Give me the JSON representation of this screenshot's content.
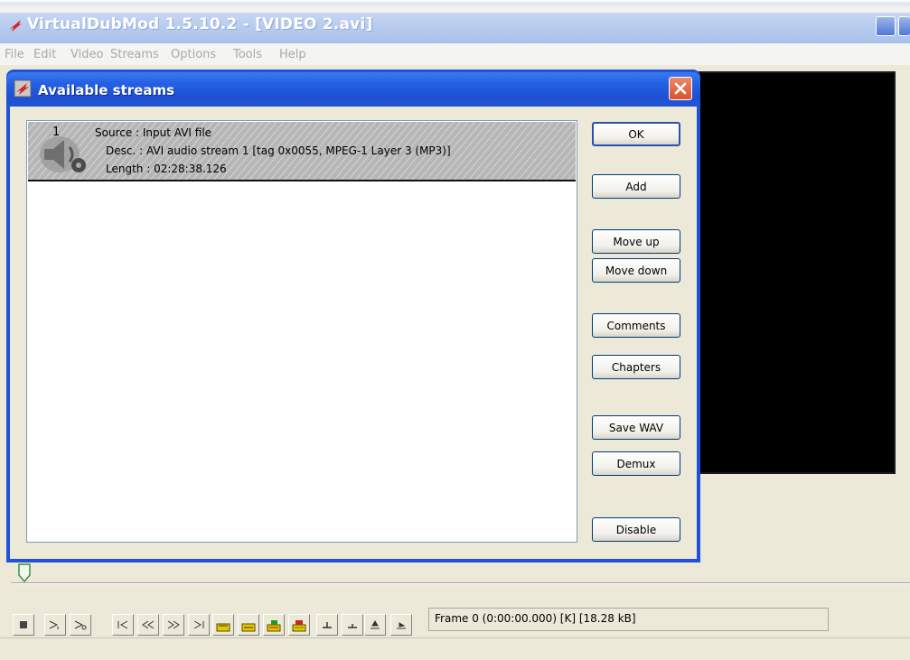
{
  "app": {
    "title": "VirtualDubMod 1.5.10.2 - [VIDEO 2.avi]",
    "menu": [
      "File",
      "Edit",
      "Video",
      "Streams",
      "Options",
      "Tools",
      "Help"
    ]
  },
  "dialog": {
    "title": "Available streams",
    "stream": {
      "number": "1",
      "source": "Source : Input AVI file",
      "desc": "Desc. : AVI audio stream 1 [tag 0x0055, MPEG-1 Layer 3 (MP3)]",
      "length": "Length : 02:28:38.126"
    },
    "buttons": {
      "ok": "OK",
      "add": "Add",
      "move_up": "Move up",
      "move_down": "Move down",
      "comments": "Comments",
      "chapters": "Chapters",
      "save_wav": "Save WAV",
      "demux": "Demux",
      "disable": "Disable"
    }
  },
  "status": {
    "frame_text": "Frame 0 (0:00:00.000) [K] [18.28 kB]"
  },
  "colors": {
    "dialog_titlebar": "#2560e4",
    "app_titlebar": "#b9cdef",
    "preview": "#000000"
  }
}
